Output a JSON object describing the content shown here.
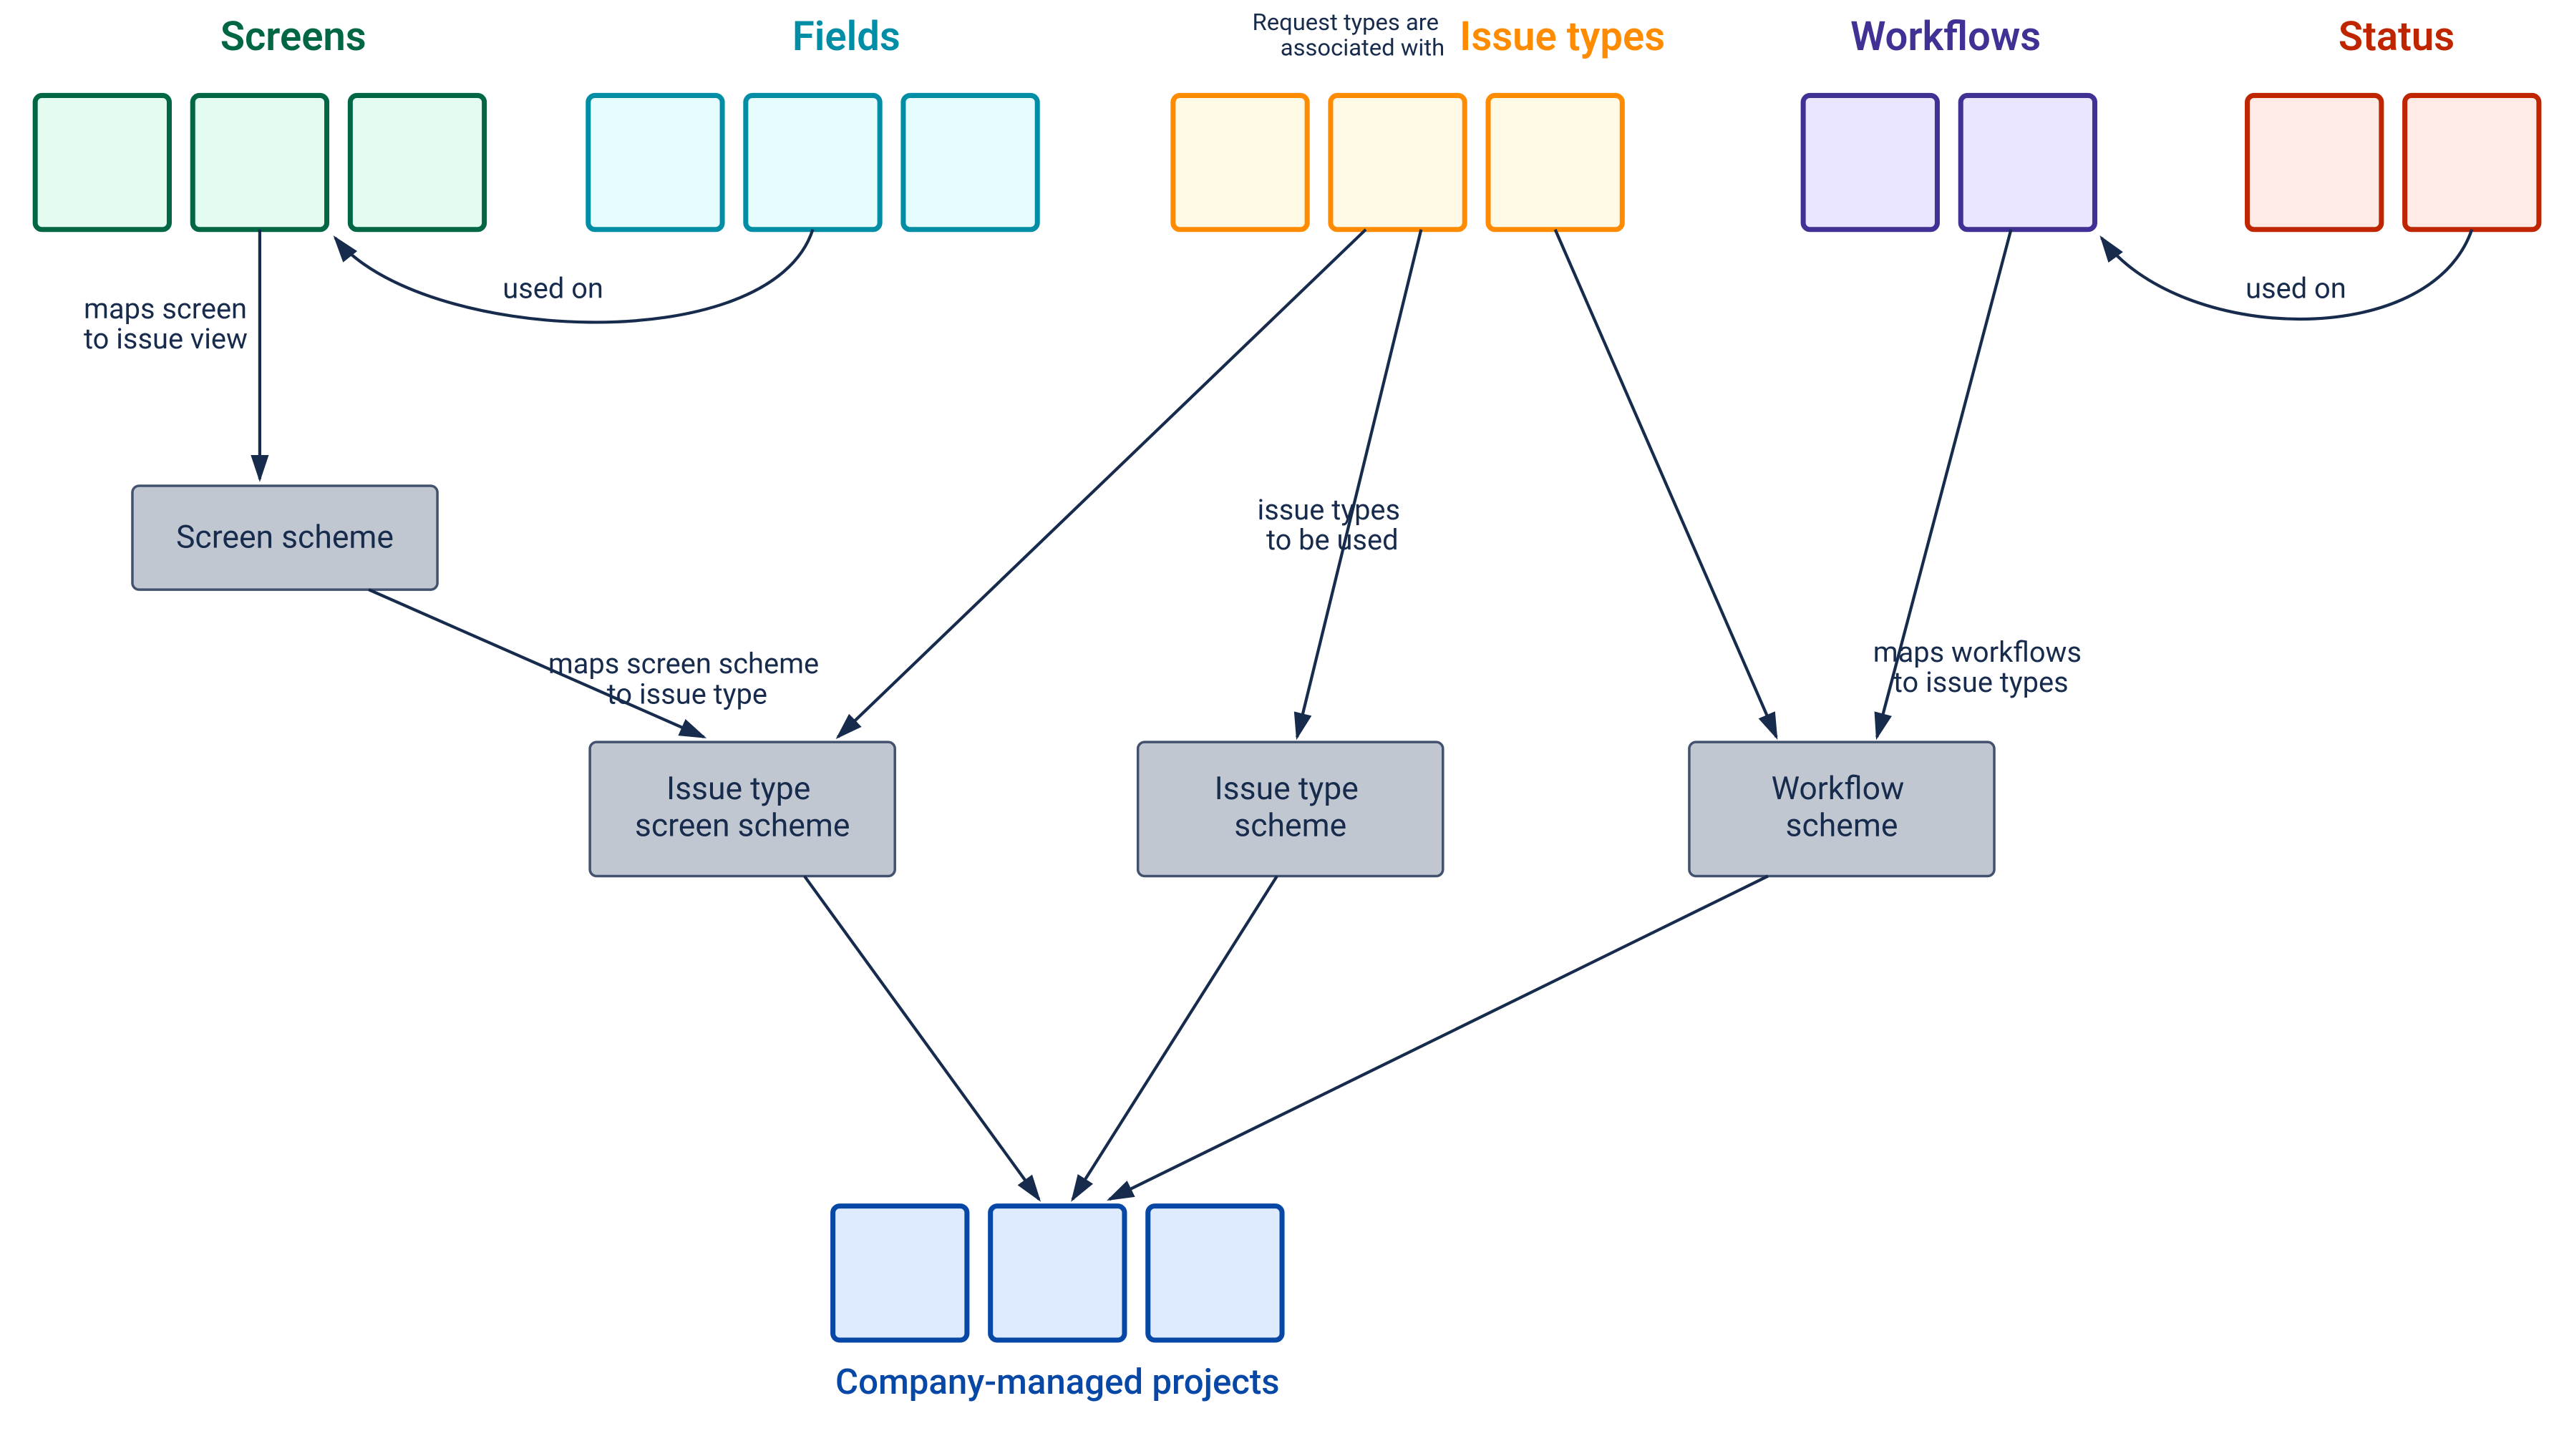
{
  "headers": {
    "screens": {
      "label": "Screens",
      "color": "#006644",
      "fill": "#E3FCEF"
    },
    "fields": {
      "label": "Fields",
      "color": "#008DA6",
      "fill": "#E6FCFF"
    },
    "issuetypes": {
      "label": "Issue types",
      "color": "#FF8B00",
      "fill": "#FFFAE6",
      "note": "Request types are\nassociated with"
    },
    "workflows": {
      "label": "Workflows",
      "color": "#403294",
      "fill": "#EAE6FF"
    },
    "status": {
      "label": "Status",
      "color": "#BF2600",
      "fill": "#FFEBE6"
    }
  },
  "schemes": {
    "screen": "Screen scheme",
    "issuetypescreen": "Issue type\nscreen scheme",
    "issuetype": "Issue type\nscheme",
    "workflow": "Workflow\nscheme"
  },
  "edges": {
    "mapsScreenToIssueView": "maps screen\nto issue view",
    "usedOnFields": "used on",
    "usedOnStatus": "used on",
    "mapsScreenSchemeToIssue": "maps screen scheme\nto issue type",
    "issueTypesToBeUsed": "issue types\nto be used",
    "mapsWorkflowsToIssue": "maps workflows\nto issue types"
  },
  "footer": {
    "label": "Company-managed projects",
    "color": "#0747A6",
    "fill": "#DEEBFF"
  }
}
